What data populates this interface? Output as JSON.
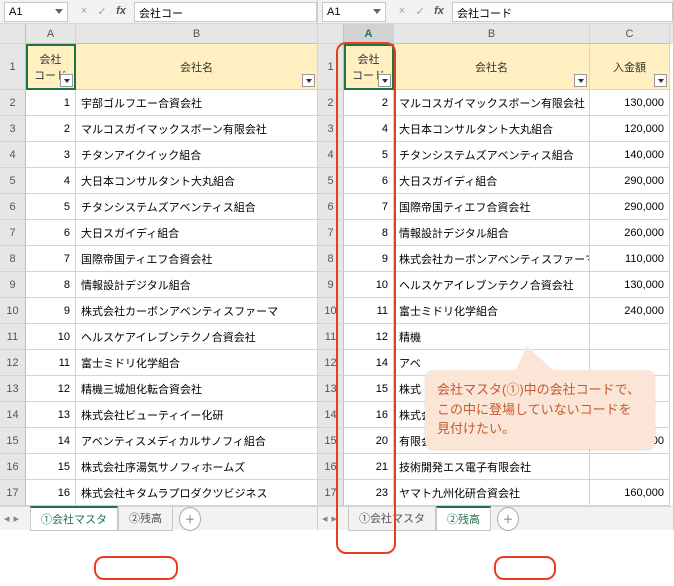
{
  "left": {
    "namebox": "A1",
    "fxcell": "会社コー",
    "cols": [
      "A",
      "B"
    ],
    "headers": {
      "code": "会社\nコード",
      "name": "会社名"
    },
    "rows": [
      {
        "r": 2,
        "code": 1,
        "name": "宇部ゴルフエー合資会社"
      },
      {
        "r": 3,
        "code": 2,
        "name": "マルコスガイマックスボーン有限会社"
      },
      {
        "r": 4,
        "code": 3,
        "name": "チタンアイクイック組合"
      },
      {
        "r": 5,
        "code": 4,
        "name": "大日本コンサルタント大丸組合"
      },
      {
        "r": 6,
        "code": 5,
        "name": "チタンシステムズアベンティス組合"
      },
      {
        "r": 7,
        "code": 6,
        "name": "大日スガイディ組合"
      },
      {
        "r": 8,
        "code": 7,
        "name": "国際帝国ティエフ合資会社"
      },
      {
        "r": 9,
        "code": 8,
        "name": "情報設計デジタル組合"
      },
      {
        "r": 10,
        "code": 9,
        "name": "株式会社カーボンアベンティスファーマ"
      },
      {
        "r": 11,
        "code": 10,
        "name": "ヘルスケアイレブンテクノ合資会社"
      },
      {
        "r": 12,
        "code": 11,
        "name": "富士ミドリ化学組合"
      },
      {
        "r": 13,
        "code": 12,
        "name": "精機三城旭化転合資会社"
      },
      {
        "r": 14,
        "code": 13,
        "name": "株式会社ビューティイー化研"
      },
      {
        "r": 15,
        "code": 14,
        "name": "アベンティスメディカルサノフィ組合"
      },
      {
        "r": 16,
        "code": 15,
        "name": "株式会社序湯気サノフィホームズ"
      },
      {
        "r": 17,
        "code": 16,
        "name": "株式会社キタムラプロダクツビジネス"
      }
    ],
    "tabs": [
      {
        "label": "①会社マスタ",
        "active": true
      },
      {
        "label": "②残高",
        "active": false
      }
    ]
  },
  "right": {
    "namebox": "A1",
    "fxcell": "会社コード",
    "cols": [
      "A",
      "B",
      "C"
    ],
    "headers": {
      "code": "会社\nコード",
      "name": "会社名",
      "amount": "入金額"
    },
    "rows": [
      {
        "r": 2,
        "code": 2,
        "name": "マルコスガイマックスボーン有限会社",
        "amount": "130,000"
      },
      {
        "r": 3,
        "code": 4,
        "name": "大日本コンサルタント大丸組合",
        "amount": "120,000"
      },
      {
        "r": 4,
        "code": 5,
        "name": "チタンシステムズアベンティス組合",
        "amount": "140,000"
      },
      {
        "r": 5,
        "code": 6,
        "name": "大日スガイディ組合",
        "amount": "290,000"
      },
      {
        "r": 6,
        "code": 7,
        "name": "国際帝国ティエフ合資会社",
        "amount": "290,000"
      },
      {
        "r": 7,
        "code": 8,
        "name": "情報設計デジタル組合",
        "amount": "260,000"
      },
      {
        "r": 8,
        "code": 9,
        "name": "株式会社カーボンアベンティスファーマ",
        "amount": "110,000"
      },
      {
        "r": 9,
        "code": 10,
        "name": "ヘルスケアイレブンテクノ合資会社",
        "amount": "130,000"
      },
      {
        "r": 10,
        "code": 11,
        "name": "富士ミドリ化学組合",
        "amount": "240,000"
      },
      {
        "r": 11,
        "code": 12,
        "name": "精機",
        "amount": ""
      },
      {
        "r": 12,
        "code": 14,
        "name": "アベ",
        "amount": ""
      },
      {
        "r": 13,
        "code": 15,
        "name": "株式",
        "amount": ""
      },
      {
        "r": 14,
        "code": 16,
        "name": "株式会",
        "amount": ""
      },
      {
        "r": 15,
        "code": 20,
        "name": "有限会社昭和テーオー静岡",
        "amount": "220,000"
      },
      {
        "r": 16,
        "code": 21,
        "name": "技術開発エス電子有限会社",
        "amount": ""
      },
      {
        "r": 17,
        "code": 23,
        "name": "ヤマト九州化研合資会社",
        "amount": "160,000"
      }
    ],
    "tabs": [
      {
        "label": "①会社マスタ",
        "active": false
      },
      {
        "label": "②残高",
        "active": true
      }
    ]
  },
  "callout": "会社マスタ(①)中の会社コードで、この中に登場していないコードを見付けたい。"
}
